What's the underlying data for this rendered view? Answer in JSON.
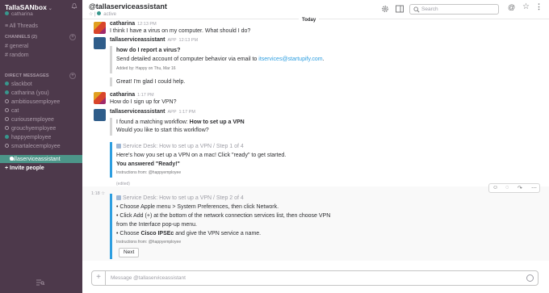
{
  "sidebar": {
    "team_name": "TallaSANbox",
    "team_chevron": "⌄",
    "current_user": "catharina",
    "all_threads": "All Threads",
    "channels_header": "CHANNELS (2)",
    "channels": [
      "# general",
      "# random"
    ],
    "dm_header": "DIRECT MESSAGES",
    "dms": [
      "slackbot",
      "catharina (you)",
      "ambitiousemployee",
      "cat",
      "curiousemployee",
      "grouchyemployee",
      "happyemployee",
      "smartalecemployee"
    ],
    "active_dm": "tallaserviceassistant",
    "invite": "+ Invite people"
  },
  "header": {
    "channel_title": "@tallaserviceassistant",
    "status": "active",
    "search_placeholder": "Search",
    "at_icon": "@",
    "star_icon": "☆",
    "more_icon": "⋮"
  },
  "divider": {
    "label": "Today"
  },
  "messages": [
    {
      "author": "catharina",
      "time": "12:13 PM",
      "text": "I think I have a virus on my computer. What should I do?"
    },
    {
      "author": "tallaserviceassistant",
      "badge": "APP",
      "time": "12:13 PM",
      "title": "how do I report a virus?",
      "body_pre": "Send detailed account of computer behavior via email to ",
      "email": "itservices@startupify.com",
      "body_post": ".",
      "footer": "Added by: Happy on Thu, Mar 16",
      "followup": "Great! I'm glad I could help."
    },
    {
      "author": "catharina",
      "time": "1:17 PM",
      "text": "How do I sign up for VPN?"
    },
    {
      "author": "tallaserviceassistant",
      "badge": "APP",
      "time": "1:17 PM",
      "line1_pre": "I found a matching workflow: ",
      "line1_bold": "How to set up a VPN",
      "line2": "Would you like to start this workflow?",
      "step1_title": "Service Desk: How to set up a VPN / Step 1 of 4",
      "step1_text": "Here's how you set up a VPN on a mac! Click \"ready\" to get started.",
      "step1_answer": "You answered  \"Ready!\"",
      "step1_footer": "Instructions from: @happyemployee",
      "edited": "(edited)"
    }
  ],
  "step2": {
    "time": "1:18",
    "title": "Service Desk: How to set up a VPN / Step 2 of 4",
    "b1": "• Choose Apple menu > System Preferences, then click Network.",
    "b2a": "• Click Add (+) at the bottom of the network connection services list, then choose VPN",
    "b2b": "from the Interface pop-up menu.",
    "b3_pre": "• Choose ",
    "b3_bold": "Cisco IPSEc",
    "b3_post": " and give the VPN service a name.",
    "footer": "Instructions from: @happyemployee",
    "button": "Next"
  },
  "composer": {
    "plus": "+",
    "placeholder": "Message @tallaserviceassistant"
  }
}
